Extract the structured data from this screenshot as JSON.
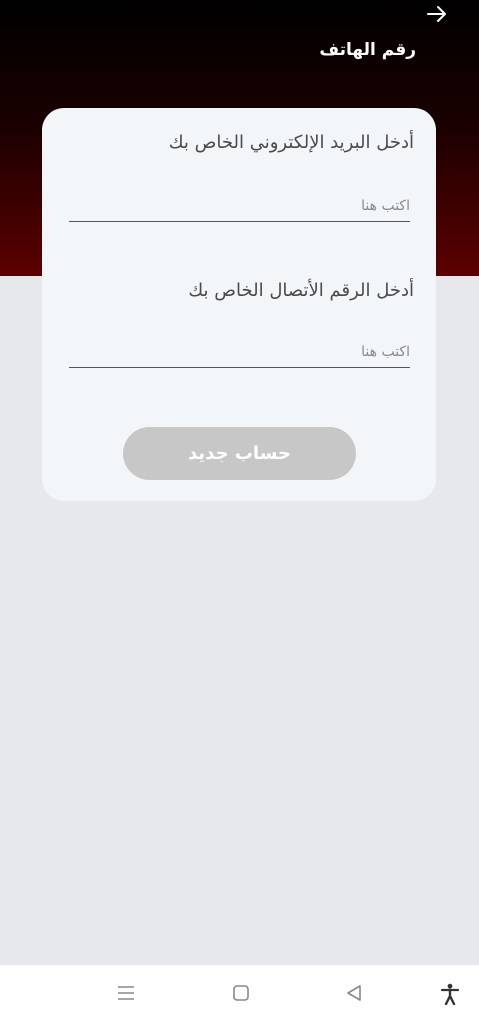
{
  "header": {
    "title": "رقم الهاتف",
    "back_icon": "arrow-right-icon"
  },
  "form": {
    "email_label": "أدخل البريد الإلكتروني الخاص بك",
    "email_placeholder": "اكتب هنا",
    "email_value": "",
    "phone_label": "أدخل الرقم الأتصال الخاص بك",
    "phone_placeholder": "اكتب هنا",
    "phone_value": "",
    "submit_label": "حساب جديد"
  },
  "nav_bar": {
    "icons": [
      "menu-icon",
      "home-square-icon",
      "back-triangle-icon",
      "accessibility-icon"
    ]
  },
  "colors": {
    "header_top": "#000000",
    "header_bottom": "#5c0000",
    "background": "#e6e8eb",
    "card": "#f3f6f9",
    "button_disabled": "#c7c7c7"
  }
}
